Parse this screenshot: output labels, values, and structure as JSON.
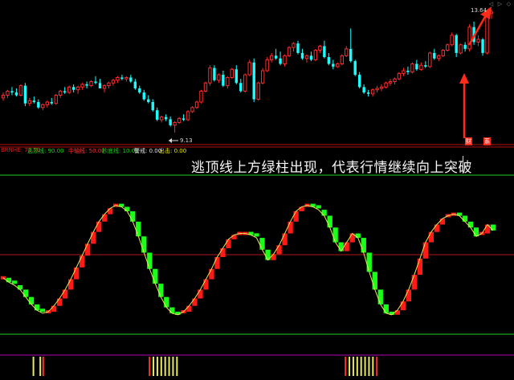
{
  "colors": {
    "background": "#000000",
    "up": "#ff2a2a",
    "down": "#19ffff",
    "osc_up": "#ff1a1a",
    "osc_down": "#19ff19",
    "line_yellow": "#e8e85a",
    "annotation_red": "#ff2a1a",
    "upper_band": "#1fcf1f",
    "mid_band": "#b01818",
    "divider": "#b01010",
    "bottom_magenta": "#b000c0"
  },
  "price_panel": {
    "high_label": "13.64",
    "low_label": "9.13",
    "arrow_icon": "up-arrow",
    "badge_left": "财",
    "badge_right": "系"
  },
  "indicator_bar": {
    "name": "BRNHE: 71.50",
    "items": [
      {
        "label": "逃顶线: 90.00",
        "color": "#1fcf1f"
      },
      {
        "label": "中轴线: 50.00",
        "color": "#ff3030"
      },
      {
        "label": "抄底线: 10.00",
        "color": "#1fcf1f"
      },
      {
        "label": "警戒: 0.00",
        "color": "#e0e0e0"
      },
      {
        "label": "出击: 0.00",
        "color": "#e8e800"
      }
    ]
  },
  "caption": "逃顶线上方绿柱出现，代表行情继续向上突破",
  "window_controls": [
    "◁",
    "▷",
    "◇"
  ],
  "candles": [
    [
      10.4,
      10.6,
      10.3,
      10.5
    ],
    [
      10.5,
      10.7,
      10.4,
      10.65
    ],
    [
      10.65,
      10.8,
      10.5,
      10.6
    ],
    [
      10.6,
      10.75,
      10.45,
      10.5
    ],
    [
      10.5,
      10.9,
      10.45,
      10.85
    ],
    [
      10.85,
      10.95,
      10.1,
      10.2
    ],
    [
      10.2,
      10.4,
      10.1,
      10.3
    ],
    [
      10.3,
      10.45,
      10.2,
      10.25
    ],
    [
      10.25,
      10.35,
      10.0,
      10.05
    ],
    [
      10.05,
      10.2,
      9.95,
      10.15
    ],
    [
      10.15,
      10.3,
      10.05,
      10.25
    ],
    [
      10.25,
      10.4,
      10.15,
      10.2
    ],
    [
      10.2,
      10.55,
      10.15,
      10.5
    ],
    [
      10.5,
      10.7,
      10.4,
      10.65
    ],
    [
      10.65,
      10.8,
      10.55,
      10.6
    ],
    [
      10.6,
      10.85,
      10.55,
      10.8
    ],
    [
      10.8,
      10.9,
      10.6,
      10.7
    ],
    [
      10.7,
      10.85,
      10.55,
      10.8
    ],
    [
      10.8,
      10.95,
      10.7,
      10.9
    ],
    [
      10.9,
      11.0,
      10.75,
      10.85
    ],
    [
      10.85,
      11.05,
      10.8,
      11.0
    ],
    [
      11.0,
      11.2,
      10.9,
      10.95
    ],
    [
      10.95,
      11.1,
      10.85,
      10.75
    ],
    [
      10.75,
      10.9,
      10.6,
      10.85
    ],
    [
      10.85,
      11.0,
      10.75,
      10.95
    ],
    [
      10.95,
      11.1,
      10.85,
      11.05
    ],
    [
      11.05,
      11.2,
      10.95,
      11.15
    ],
    [
      11.15,
      11.25,
      11.05,
      11.1
    ],
    [
      11.1,
      11.2,
      11.0,
      11.15
    ],
    [
      11.15,
      11.25,
      10.95,
      11.0
    ],
    [
      11.0,
      11.1,
      10.7,
      10.75
    ],
    [
      10.75,
      10.85,
      10.55,
      10.6
    ],
    [
      10.6,
      10.7,
      10.3,
      10.35
    ],
    [
      10.35,
      10.5,
      10.2,
      10.25
    ],
    [
      10.25,
      10.35,
      9.9,
      9.95
    ],
    [
      9.95,
      10.05,
      9.55,
      9.6
    ],
    [
      9.6,
      9.75,
      9.5,
      9.7
    ],
    [
      9.7,
      9.8,
      9.55,
      9.62
    ],
    [
      9.62,
      9.72,
      9.35,
      9.4
    ],
    [
      9.4,
      9.55,
      9.13,
      9.5
    ],
    [
      9.5,
      9.7,
      9.45,
      9.65
    ],
    [
      9.65,
      9.8,
      9.55,
      9.6
    ],
    [
      9.6,
      9.95,
      9.55,
      9.9
    ],
    [
      9.9,
      10.1,
      9.85,
      10.05
    ],
    [
      10.05,
      10.3,
      10.0,
      10.25
    ],
    [
      10.25,
      10.7,
      10.2,
      10.65
    ],
    [
      10.65,
      11.0,
      10.6,
      10.95
    ],
    [
      10.95,
      11.6,
      10.85,
      11.5
    ],
    [
      11.5,
      11.6,
      11.0,
      11.05
    ],
    [
      11.05,
      11.3,
      10.95,
      11.25
    ],
    [
      11.25,
      11.4,
      10.8,
      10.85
    ],
    [
      10.85,
      11.2,
      10.75,
      11.15
    ],
    [
      11.15,
      11.5,
      11.1,
      11.45
    ],
    [
      11.45,
      11.6,
      10.9,
      10.95
    ],
    [
      10.95,
      11.1,
      10.6,
      10.65
    ],
    [
      10.65,
      11.3,
      10.6,
      11.25
    ],
    [
      11.25,
      11.8,
      11.2,
      11.7
    ],
    [
      11.7,
      11.85,
      10.25,
      10.35
    ],
    [
      10.35,
      11.0,
      10.3,
      10.95
    ],
    [
      10.95,
      11.5,
      10.9,
      11.4
    ],
    [
      11.4,
      11.9,
      11.35,
      11.8
    ],
    [
      11.8,
      12.05,
      11.7,
      11.95
    ],
    [
      11.95,
      12.2,
      11.8,
      11.85
    ],
    [
      11.85,
      12.1,
      11.6,
      11.65
    ],
    [
      11.65,
      12.0,
      11.55,
      11.95
    ],
    [
      11.95,
      12.3,
      11.9,
      12.25
    ],
    [
      12.25,
      12.45,
      12.1,
      12.4
    ],
    [
      12.4,
      12.5,
      12.0,
      12.05
    ],
    [
      12.05,
      12.2,
      11.8,
      11.85
    ],
    [
      11.85,
      12.0,
      11.7,
      11.95
    ],
    [
      11.95,
      12.1,
      11.75,
      11.8
    ],
    [
      11.8,
      12.2,
      11.75,
      12.15
    ],
    [
      12.15,
      12.35,
      12.05,
      12.3
    ],
    [
      12.3,
      12.5,
      11.85,
      11.9
    ],
    [
      11.9,
      12.05,
      11.6,
      11.65
    ],
    [
      11.65,
      11.8,
      11.45,
      11.55
    ],
    [
      11.55,
      11.7,
      11.5,
      11.65
    ],
    [
      11.65,
      12.0,
      11.6,
      11.95
    ],
    [
      11.95,
      12.3,
      11.9,
      12.2
    ],
    [
      12.2,
      12.95,
      11.7,
      11.75
    ],
    [
      11.75,
      11.8,
      11.2,
      11.25
    ],
    [
      11.25,
      11.35,
      10.75,
      10.8
    ],
    [
      10.8,
      10.9,
      10.55,
      10.6
    ],
    [
      10.6,
      10.7,
      10.45,
      10.55
    ],
    [
      10.55,
      10.75,
      10.45,
      10.7
    ],
    [
      10.7,
      10.85,
      10.6,
      10.75
    ],
    [
      10.75,
      10.9,
      10.65,
      10.8
    ],
    [
      10.8,
      11.0,
      10.75,
      10.95
    ],
    [
      10.95,
      11.1,
      10.85,
      11.0
    ],
    [
      11.0,
      11.15,
      10.9,
      11.1
    ],
    [
      11.1,
      11.35,
      11.05,
      11.3
    ],
    [
      11.3,
      11.5,
      11.2,
      11.4
    ],
    [
      11.4,
      11.55,
      11.25,
      11.35
    ],
    [
      11.35,
      11.7,
      11.3,
      11.65
    ],
    [
      11.65,
      11.8,
      11.4,
      11.45
    ],
    [
      11.45,
      11.7,
      11.4,
      11.6
    ],
    [
      11.6,
      11.75,
      11.5,
      11.55
    ],
    [
      11.55,
      12.1,
      11.5,
      12.05
    ],
    [
      12.05,
      12.2,
      11.8,
      11.85
    ],
    [
      11.85,
      12.0,
      11.75,
      11.95
    ],
    [
      11.95,
      12.2,
      11.9,
      12.15
    ],
    [
      12.15,
      12.4,
      12.1,
      12.35
    ],
    [
      12.35,
      12.8,
      12.3,
      12.7
    ],
    [
      12.7,
      12.75,
      11.9,
      12.05
    ],
    [
      12.05,
      12.4,
      12.0,
      12.35
    ],
    [
      12.35,
      12.45,
      12.1,
      12.2
    ],
    [
      12.2,
      13.1,
      12.1,
      13.0
    ],
    [
      13.0,
      13.2,
      12.35,
      12.45
    ],
    [
      12.45,
      12.7,
      12.3,
      12.55
    ],
    [
      12.55,
      12.6,
      11.95,
      12.05
    ],
    [
      12.05,
      13.6,
      12.0,
      13.5
    ],
    [
      13.5,
      13.64,
      13.3,
      13.55
    ]
  ],
  "oscillator": {
    "values": [
      36,
      33,
      31,
      28,
      23,
      18,
      14,
      12,
      13,
      17,
      22,
      28,
      35,
      43,
      51,
      59,
      67,
      74,
      79,
      83,
      85,
      84,
      81,
      74,
      64,
      53,
      42,
      32,
      23,
      16,
      12,
      11,
      13,
      17,
      22,
      28,
      35,
      42,
      50,
      56,
      62,
      65,
      66,
      66,
      65,
      63,
      55,
      48,
      52,
      58,
      66,
      74,
      81,
      84,
      85,
      84,
      82,
      78,
      70,
      60,
      54,
      60,
      66,
      63,
      53,
      40,
      28,
      18,
      12,
      11,
      14,
      20,
      28,
      38,
      49,
      60,
      67,
      72,
      76,
      78,
      79,
      78,
      74,
      70,
      64,
      66,
      72,
      68
    ]
  },
  "bottom_signals": [
    {
      "pos": 0.06,
      "color": "#e8e85a"
    },
    {
      "pos": 0.074,
      "color": "#e8e85a"
    },
    {
      "pos": 0.08,
      "color": "#ff3030"
    },
    {
      "pos": 0.297,
      "color": "#ff3030"
    },
    {
      "pos": 0.305,
      "color": "#e8e85a"
    },
    {
      "pos": 0.313,
      "color": "#e8e85a"
    },
    {
      "pos": 0.321,
      "color": "#e8e85a"
    },
    {
      "pos": 0.329,
      "color": "#e8e85a"
    },
    {
      "pos": 0.337,
      "color": "#e8e85a"
    },
    {
      "pos": 0.345,
      "color": "#e8e85a"
    },
    {
      "pos": 0.353,
      "color": "#e8e85a"
    },
    {
      "pos": 0.697,
      "color": "#ff3030"
    },
    {
      "pos": 0.705,
      "color": "#e8e85a"
    },
    {
      "pos": 0.713,
      "color": "#e8e85a"
    },
    {
      "pos": 0.721,
      "color": "#e8e85a"
    },
    {
      "pos": 0.729,
      "color": "#e8e85a"
    },
    {
      "pos": 0.737,
      "color": "#e8e85a"
    },
    {
      "pos": 0.745,
      "color": "#e8e85a"
    },
    {
      "pos": 0.753,
      "color": "#e8e85a"
    },
    {
      "pos": 0.761,
      "color": "#ff3030"
    }
  ]
}
